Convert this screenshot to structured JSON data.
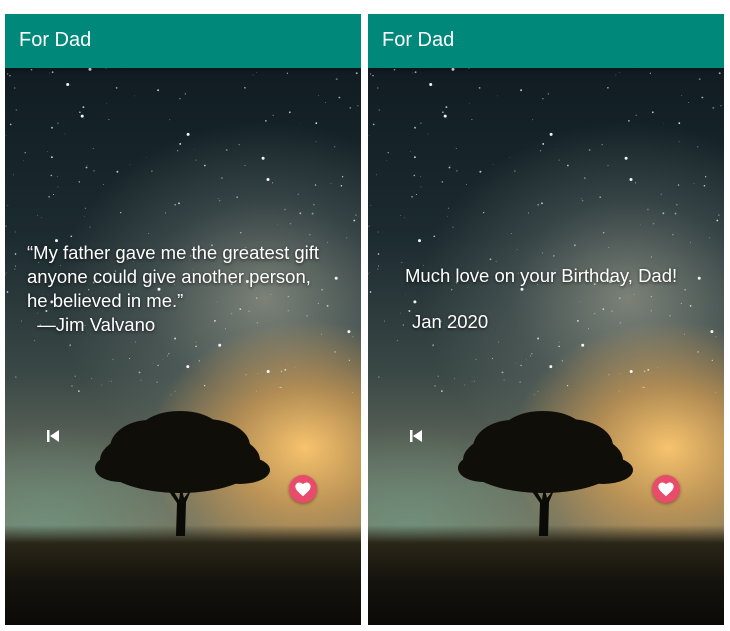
{
  "screens": [
    {
      "app_title": "For Dad",
      "message_lines": [
        "“My father gave me the greatest gift",
        "anyone could give another person,",
        "he believed in me.”",
        "  —Jim Valvano"
      ],
      "prev_icon": "skip-previous-icon",
      "like_icon": "heart-icon"
    },
    {
      "app_title": "For Dad",
      "message_lines": [
        "Much love on your Birthday, Dad!",
        "",
        "Jan 2020"
      ],
      "prev_icon": "skip-previous-icon",
      "like_icon": "heart-icon"
    }
  ],
  "colors": {
    "appbar": "#00897b",
    "heart_button": "#e84c6a",
    "text": "#ffffff"
  }
}
